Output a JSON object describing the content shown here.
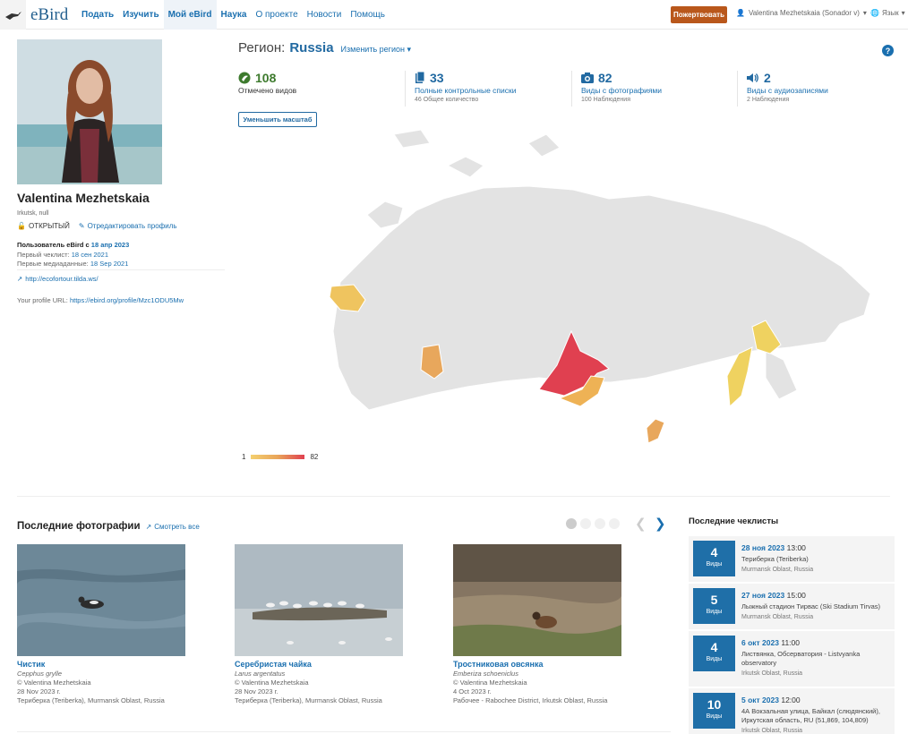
{
  "header": {
    "logo_text": "eBird",
    "nav": [
      {
        "label": "Подать",
        "bold": true,
        "active": false
      },
      {
        "label": "Изучить",
        "bold": true,
        "active": false
      },
      {
        "label": "Мой eBird",
        "bold": true,
        "active": true
      },
      {
        "label": "Наука",
        "bold": true,
        "active": false
      },
      {
        "label": "О проекте",
        "bold": false,
        "active": false
      },
      {
        "label": "Новости",
        "bold": false,
        "active": false
      },
      {
        "label": "Помощь",
        "bold": false,
        "active": false
      }
    ],
    "donate_label": "Пожертвовать",
    "user_label": "Valentina Mezhetskaia (Sonador v)",
    "language_label": "Язык"
  },
  "profile": {
    "name": "Valentina Mezhetskaia",
    "location": "Irkutsk, null",
    "visibility": "ОТКРЫТЫЙ",
    "edit_label": "Отредактировать профиль",
    "since_prefix": "Пользователь eBird с",
    "since_date": "18 апр 2023",
    "first_checklist_label": "Первый чеклист:",
    "first_checklist_date": "18 сен 2021",
    "first_media_label": "Первые медиаданные:",
    "first_media_date": "18 Sep 2021",
    "website": "http://ecofortour.tilda.ws/",
    "profile_url_label": "Your profile URL:",
    "profile_url": "https://ebird.org/profile/Mzc1ODU5Mw"
  },
  "region": {
    "label": "Регион:",
    "name": "Russia",
    "change_label": "Изменить регион"
  },
  "stats": [
    {
      "num": "108",
      "label": "Отмечено видов",
      "sub": ""
    },
    {
      "num": "33",
      "label": "Полные контрольные списки",
      "sub": "46 Общее количество"
    },
    {
      "num": "82",
      "label": "Виды с фотографиями",
      "sub": "100 Наблюдения"
    },
    {
      "num": "2",
      "label": "Виды с аудиозаписями",
      "sub": "2 Наблюдения"
    }
  ],
  "zoom_label": "Уменьшить масштаб",
  "legend": {
    "min": "1",
    "max": "82"
  },
  "colors": {
    "brand": "#2169a1",
    "donate": "#b9571b",
    "map_high": "#e04050",
    "map_low": "#f4d06f",
    "map_base": "#e3e3e3"
  },
  "photos": {
    "title": "Последние фотографии",
    "see_all": "Смотреть все",
    "items": [
      {
        "title": "Чистик",
        "sci": "Cepphus grylle",
        "credit": "© Valentina Mezhetskaia",
        "date": "28 Nov 2023 г.",
        "place": "Териберка (Teriberka), Murmansk Oblast, Russia"
      },
      {
        "title": "Серебристая чайка",
        "sci": "Larus argentatus",
        "credit": "© Valentina Mezhetskaia",
        "date": "28 Nov 2023 г.",
        "place": "Териберка (Teriberka), Murmansk Oblast, Russia"
      },
      {
        "title": "Тростниковая овсянка",
        "sci": "Emberiza schoeniclus",
        "credit": "© Valentina Mezhetskaia",
        "date": "4 Oct 2023 г.",
        "place": "Рабочее - Rabochee District, Irkutsk Oblast, Russia"
      }
    ]
  },
  "checklists": {
    "title": "Последние чеклисты",
    "items": [
      {
        "count": "4",
        "unit": "Виды",
        "date": "28 ноя 2023",
        "time": "13:00",
        "location": "Териберка (Teriberka)",
        "region": "Murmansk Oblast, Russia"
      },
      {
        "count": "5",
        "unit": "Виды",
        "date": "27 ноя 2023",
        "time": "15:00",
        "location": "Лыжный стадион Тирвас (Ski Stadium Tirvas)",
        "region": "Murmansk Oblast, Russia"
      },
      {
        "count": "4",
        "unit": "Виды",
        "date": "6 окт 2023",
        "time": "11:00",
        "location": "Листвянка, Обсерватория - Listvyanka observatory",
        "region": "Irkutsk Oblast, Russia"
      },
      {
        "count": "10",
        "unit": "Виды",
        "date": "5 окт 2023",
        "time": "12:00",
        "location": "4А Вокзальная улица, Байкал (слюдянский), Иркутская область, RU (51,869, 104,809)",
        "region": "Irkutsk Oblast, Russia"
      }
    ]
  }
}
